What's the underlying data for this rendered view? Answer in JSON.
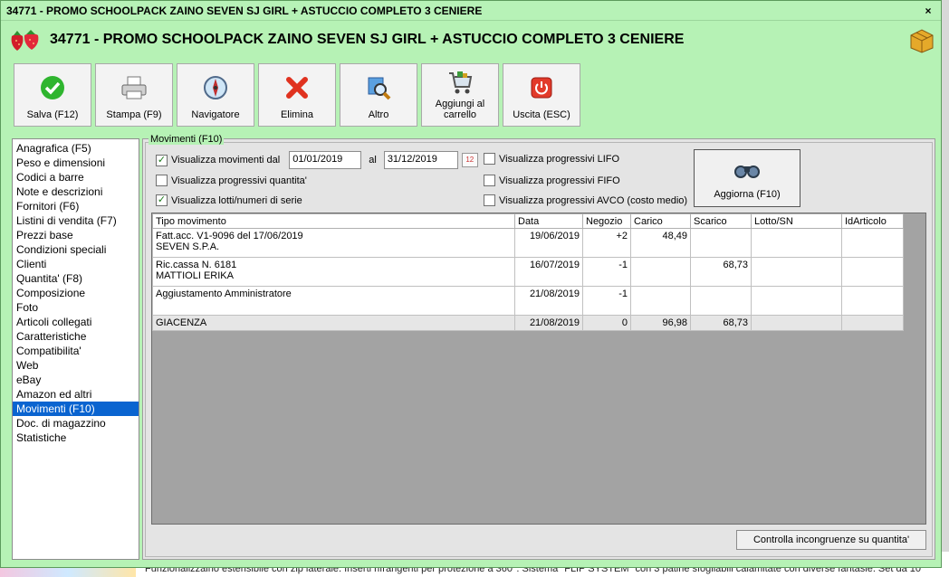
{
  "window": {
    "titlebar": "34771 - PROMO SCHOOLPACK ZAINO SEVEN SJ GIRL + ASTUCCIO COMPLETO 3 CENIERE",
    "header_title": "34771 - PROMO SCHOOLPACK ZAINO SEVEN SJ GIRL + ASTUCCIO COMPLETO 3 CENIERE",
    "close": "×"
  },
  "toolbar": {
    "save": "Salva (F12)",
    "print": "Stampa (F9)",
    "navigator": "Navigatore",
    "delete": "Elimina",
    "other": "Altro",
    "cart_1": "Aggiungi al",
    "cart_2": "carrello",
    "exit": "Uscita (ESC)"
  },
  "sidebar": {
    "items": [
      "Anagrafica (F5)",
      "Peso e dimensioni",
      "Codici a barre",
      "Note e descrizioni",
      "Fornitori (F6)",
      "Listini di vendita (F7)",
      "Prezzi base",
      "Condizioni speciali",
      "Clienti",
      "Quantita' (F8)",
      "Composizione",
      "Foto",
      "Articoli collegati",
      "Caratteristiche",
      "Compatibilita'",
      "Web",
      "eBay",
      "Amazon ed altri",
      "Movimenti (F10)",
      "Doc. di magazzino",
      "Statistiche"
    ],
    "selected_index": 18
  },
  "movimenti": {
    "group_label": "Movimenti (F10)",
    "show_movements_label": "Visualizza movimenti dal",
    "date_from": "01/01/2019",
    "al_label": "al",
    "date_to": "31/12/2019",
    "progressive_qty_label": "Visualizza progressivi quantita'",
    "lots_label": "Visualizza lotti/numeri di serie",
    "lifo_label": "Visualizza progressivi LIFO",
    "fifo_label": "Visualizza progressivi FIFO",
    "avco_label": "Visualizza progressivi AVCO (costo medio)",
    "refresh_button": "Aggiorna (F10)",
    "check_button": "Controlla incongruenze su quantita'",
    "cal_icon": "12",
    "check_mark": "✓"
  },
  "table": {
    "headers": [
      "Tipo movimento",
      "Data",
      "Negozio",
      "Carico",
      "Scarico",
      "Lotto/SN",
      "IdArticolo"
    ],
    "rows": [
      {
        "tipo1": "Fatt.acc. V1-9096 del 17/06/2019",
        "tipo2": "SEVEN S.P.A.",
        "data": "19/06/2019",
        "negozio": "+2",
        "carico": "48,49",
        "scarico": "",
        "lotto": "",
        "id": ""
      },
      {
        "tipo1": "Ric.cassa N. 6181",
        "tipo2": "MATTIOLI ERIKA",
        "data": "16/07/2019",
        "negozio": "-1",
        "carico": "",
        "scarico": "68,73",
        "lotto": "",
        "id": ""
      },
      {
        "tipo1": "Aggiustamento Amministratore",
        "tipo2": "",
        "data": "21/08/2019",
        "negozio": "-1",
        "carico": "",
        "scarico": "",
        "lotto": "",
        "id": ""
      }
    ],
    "total": {
      "tipo": "GIACENZA",
      "data": "21/08/2019",
      "negozio": "0",
      "carico": "96,98",
      "scarico": "68,73"
    }
  },
  "background": {
    "text": "Funzionalizzaino estensibile con zip laterale. Inserti rifrangenti per protezione a 360°. Sistema \"FLIP SYSTEM\" con 3 patine sfogliabili calamitate con diverse fantasie. Set da 10"
  }
}
